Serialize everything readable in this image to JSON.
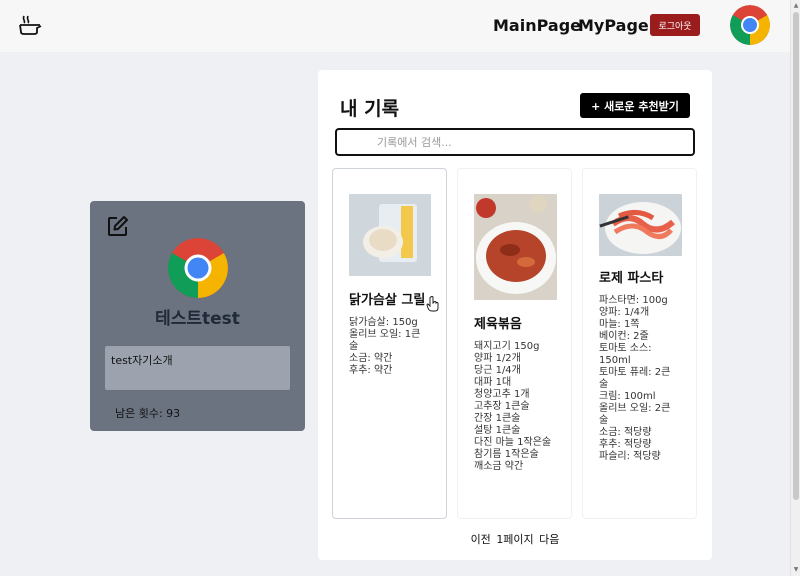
{
  "nav": {
    "links": [
      "MainPage",
      "MyPage"
    ],
    "logout_label": "로그아웃"
  },
  "profile": {
    "name": "테스트test",
    "intro": "test자기소개",
    "remaining": "남은 횟수: 93"
  },
  "records": {
    "title": "내 기록",
    "new_button": "+ 새로운 추천받기",
    "search_placeholder": "기록에서 검색...",
    "cards": [
      {
        "title": "닭가슴살 그릴",
        "ingredients": [
          "닭가슴살: 150g",
          "올리브 오일: 1큰",
          "술",
          "소금: 약간",
          "후추: 약간"
        ]
      },
      {
        "title": "제육볶음",
        "ingredients": [
          "돼지고기 150g",
          "양파 1/2개",
          "당근 1/4개",
          "대파 1대",
          "청양고추 1개",
          "고추장 1큰술",
          "간장 1큰술",
          "설탕 1큰술",
          "다진 마늘 1작은술",
          "참기름 1작은술",
          "깨소금 약간"
        ]
      },
      {
        "title": "로제 파스타",
        "ingredients": [
          "파스타면: 100g",
          "양파: 1/4개",
          "마늘: 1쪽",
          "베이컨: 2줄",
          "토마토 소스:",
          "150ml",
          "토마토 퓨레: 2큰",
          "술",
          "크림: 100ml",
          "올리브 오일: 2큰",
          "술",
          "소금: 적당량",
          "후추: 적당량",
          "파슬리: 적당량"
        ]
      }
    ],
    "pagination": {
      "prev": "이전",
      "page": "1페이지",
      "next": "다음"
    }
  },
  "colors": {
    "profile_bg": "#6b7280",
    "logout_bg": "#9b1c1c"
  }
}
